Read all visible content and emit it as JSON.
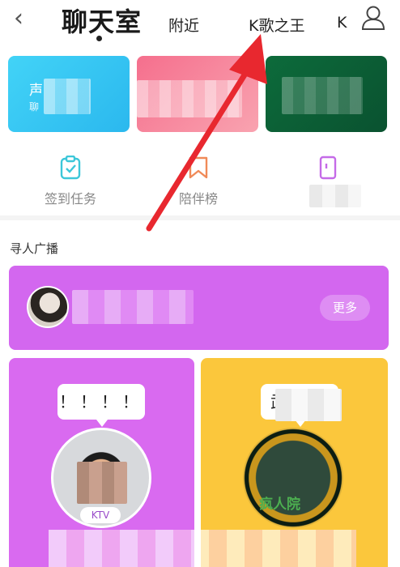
{
  "header": {
    "back_icon": "chevron-left-icon",
    "tabs": [
      {
        "label": "聊天室",
        "active": true
      },
      {
        "label": "附近",
        "active": false
      },
      {
        "label": "K歌之王",
        "active": false
      },
      {
        "label": "K",
        "active": false
      }
    ],
    "user_icon": "user-icon"
  },
  "banners": [
    {
      "title": "声",
      "subtitle": "聊",
      "color": "#42d3f7"
    },
    {
      "title": "",
      "subtitle": "",
      "color": "#f56f8d"
    },
    {
      "title": "",
      "subtitle": "",
      "color": "#0d6b3b"
    }
  ],
  "quick_actions": [
    {
      "label": "签到任务",
      "icon": "clipboard-check-icon",
      "color": "#3cc7d9"
    },
    {
      "label": "陪伴榜",
      "icon": "bookmark-icon",
      "color": "#f08a58"
    },
    {
      "label": "我",
      "icon": "phone-icon",
      "color": "#c56be8"
    }
  ],
  "section": {
    "title": "寻人广播",
    "more_label": "更多"
  },
  "cards": [
    {
      "bubble_text": "！！！！",
      "badge": "KTV",
      "color": "#d96af0"
    },
    {
      "bubble_text": "武",
      "stamp_text": "疯人院",
      "color": "#fbc73c"
    }
  ],
  "annotation": {
    "arrow_color": "#e8282f"
  }
}
